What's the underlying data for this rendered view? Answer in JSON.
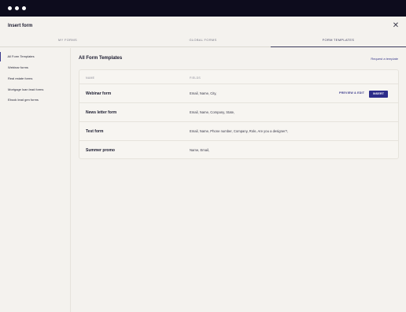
{
  "modal": {
    "title": "Insert form"
  },
  "tabs": [
    {
      "label": "MY FORMS"
    },
    {
      "label": "GLOBAL FORMS"
    },
    {
      "label": "FORM TEMPLATES"
    }
  ],
  "sidebar": {
    "items": [
      {
        "label": "All Form Templates"
      },
      {
        "label": "Webinar forms"
      },
      {
        "label": "Real estate forms"
      },
      {
        "label": "Mortgage loan lead forms"
      },
      {
        "label": "Ebook lead gen forms"
      }
    ]
  },
  "main": {
    "title": "All Form Templates",
    "request_link": "Request a template",
    "table": {
      "headers": {
        "name": "NAME",
        "fields": "FIELDS"
      },
      "rows": [
        {
          "name": "Webinar form",
          "fields": "Email, Name, City,"
        },
        {
          "name": "News letter form",
          "fields": "Email, Name, Company, State,"
        },
        {
          "name": "Test form",
          "fields": "Email, Name, Phone number, Company, Role, Are you a designer?,"
        },
        {
          "name": "Summer promo",
          "fields": "Name, Email,"
        }
      ],
      "row_actions": {
        "preview_label": "PREVIEW & EDIT",
        "insert_label": "INSERT"
      }
    }
  },
  "icons": {
    "close": "close-icon"
  },
  "colors": {
    "accent": "#2d2d8a",
    "titlebar": "#0d0c1d",
    "background": "#f4f2ee"
  }
}
